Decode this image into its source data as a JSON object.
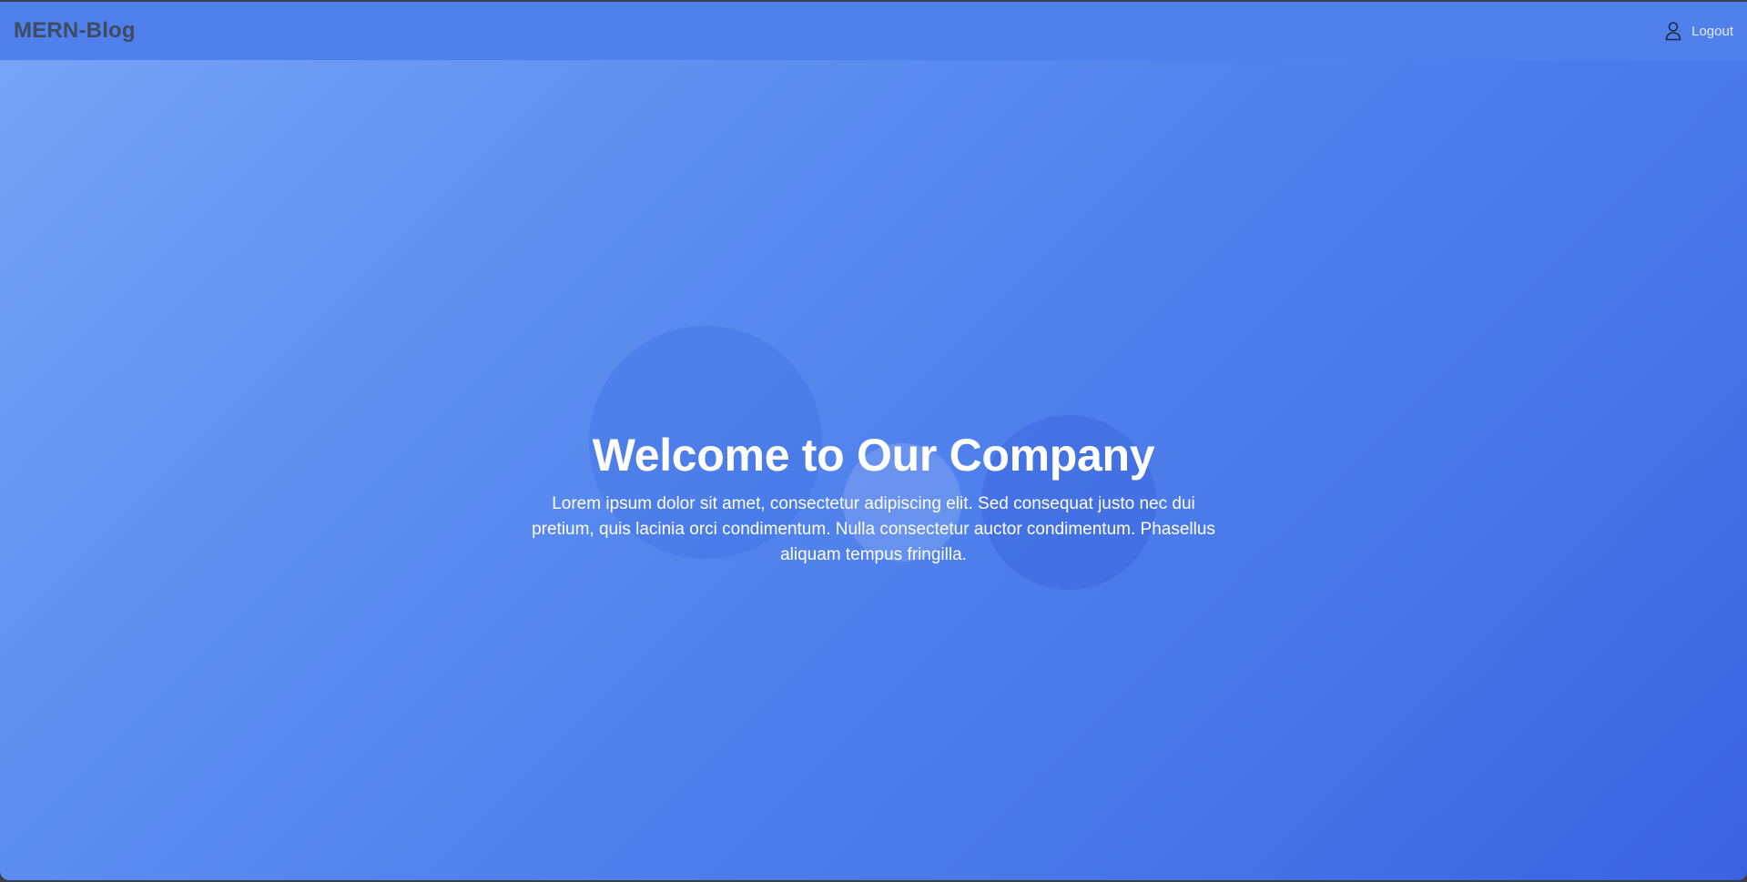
{
  "navbar": {
    "brand": "MERN-Blog",
    "logout_label": "Logout",
    "logout_icon": "user-icon"
  },
  "hero": {
    "title": "Welcome to Our Company",
    "text": "Lorem ipsum dolor sit amet, consectetur adipiscing elit. Sed consequat justo nec dui pretium, quis lacinia orci condimentum. Nulla consectetur auctor condimentum. Phasellus aliquam tempus fringilla."
  },
  "colors": {
    "navbar_bg": "#4f80ec",
    "gradient_start": "#78a5f6",
    "gradient_end": "#3b62e2",
    "brand_text": "#3e4b60"
  }
}
